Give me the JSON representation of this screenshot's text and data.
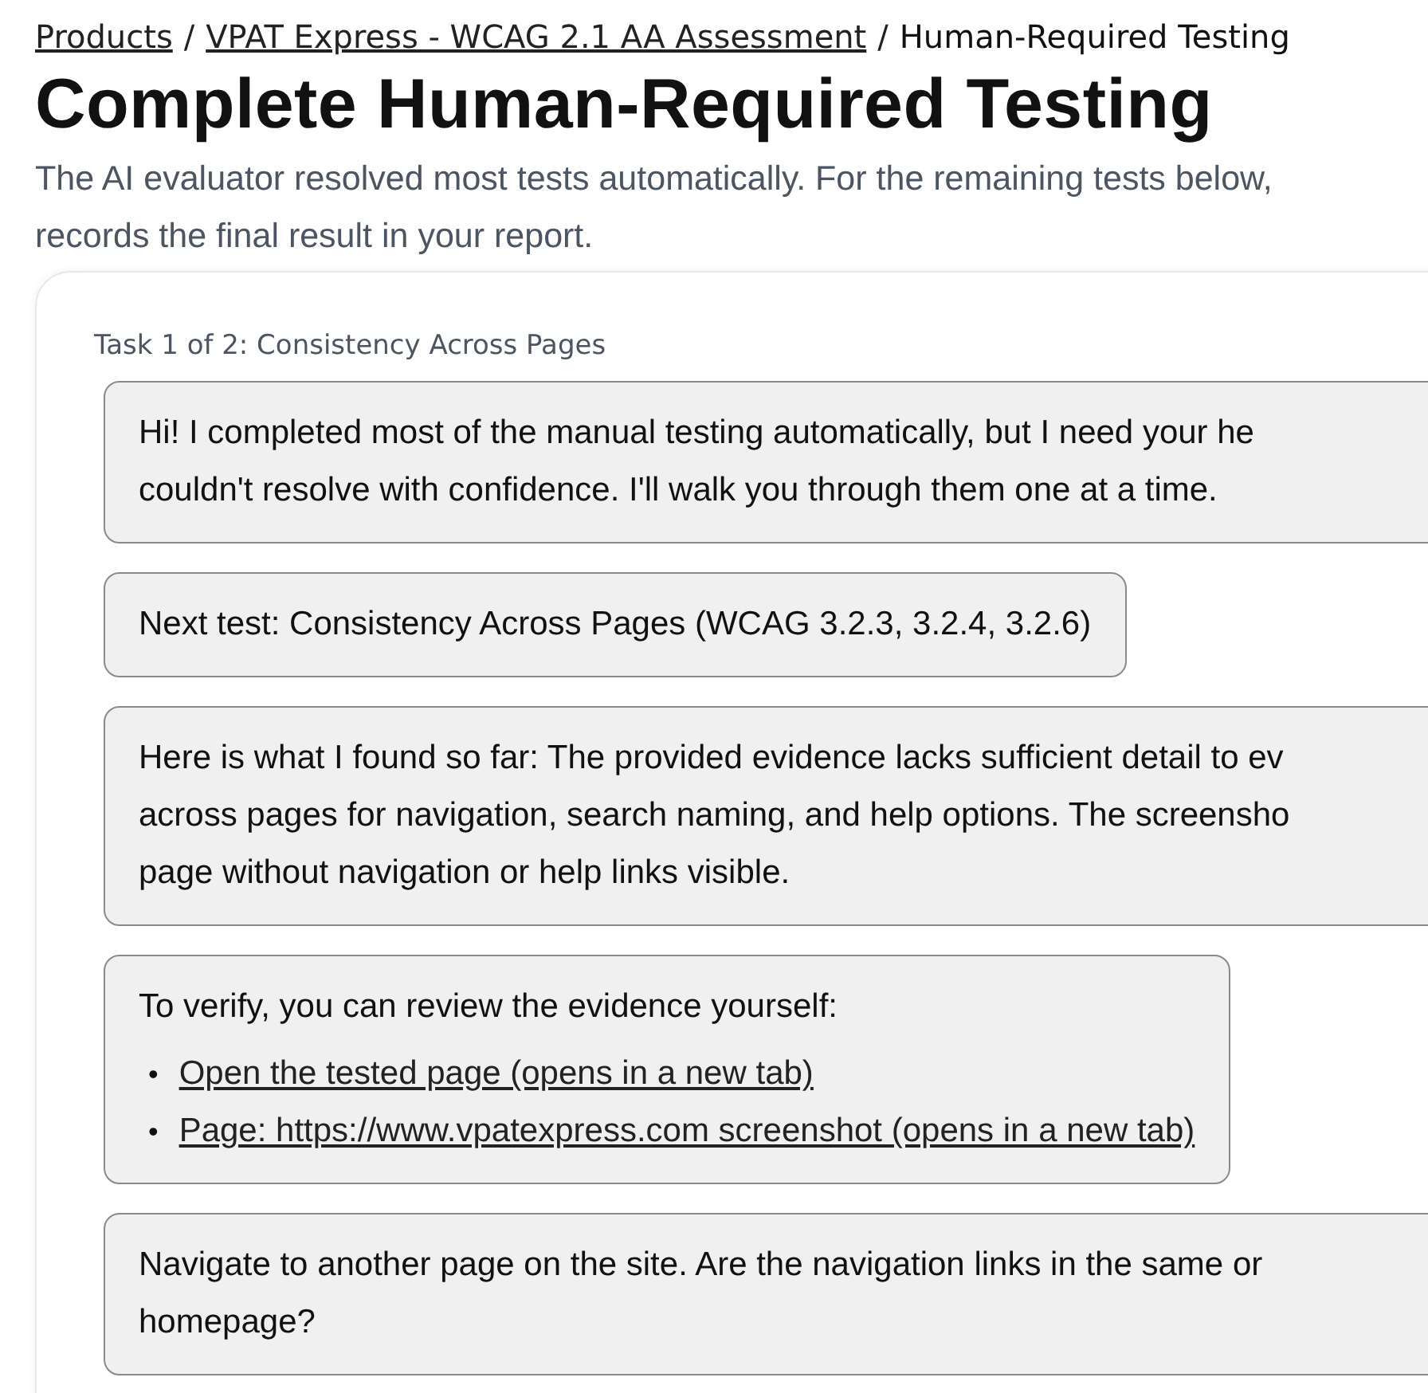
{
  "breadcrumb": [
    {
      "label": "Products",
      "link": true
    },
    {
      "separator": "/",
      "label": "VPAT Express - WCAG 2.1 AA Assessment",
      "link": true
    },
    {
      "separator": "/",
      "label": "Human-Required Testing",
      "link": false
    }
  ],
  "title": "Complete Human-Required Testing",
  "intro": [
    "The AI evaluator resolved most tests automatically. For the remaining tests below,",
    "records the final result in your report."
  ],
  "task_label": "Task 1 of 2: Consistency Across Pages",
  "messages": [
    {
      "kind": "cut",
      "lines": [
        "Hi! I completed most of the manual testing automatically, but I need your he",
        "couldn't resolve with confidence. I'll walk you through them one at a time."
      ]
    },
    {
      "kind": "fit",
      "lines": [
        "Next test: Consistency Across Pages (WCAG 3.2.3, 3.2.4, 3.2.6)"
      ]
    },
    {
      "kind": "cut",
      "lines": [
        "Here is what I found so far: The provided evidence lacks sufficient detail to ev",
        "across pages for navigation, search naming, and help options. The screensho",
        "page without navigation or help links visible."
      ]
    },
    {
      "kind": "fit",
      "lines": [
        "To verify, you can review the evidence yourself:"
      ],
      "links": [
        {
          "bullet": "•",
          "label": "Open the tested page (opens in a new tab)"
        },
        {
          "bullet": "•",
          "label": "Page: https://www.vpatexpress.com screenshot (opens in a new tab)"
        }
      ]
    },
    {
      "kind": "cut",
      "lines": [
        "Navigate to another page on the site. Are the navigation links in the same or",
        "homepage?"
      ]
    }
  ]
}
